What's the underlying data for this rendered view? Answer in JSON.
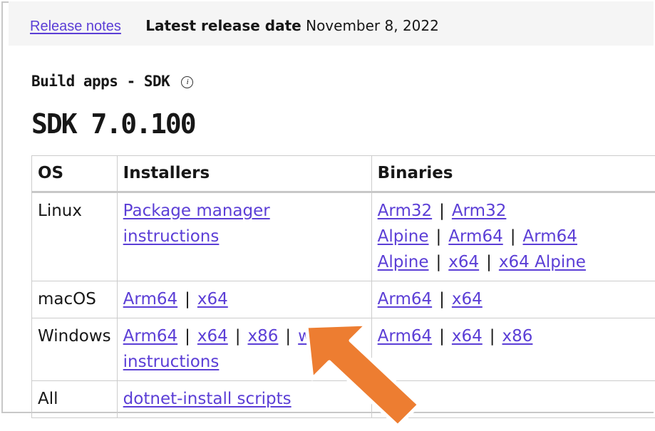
{
  "header": {
    "release_notes_link": "Release notes",
    "latest_release_label": "Latest release date",
    "latest_release_date": "November 8, 2022"
  },
  "section": {
    "title": "Build apps - SDK",
    "info_icon": "info-icon"
  },
  "sdk": {
    "title": "SDK 7.0.100"
  },
  "table": {
    "columns": [
      "OS",
      "Installers",
      "Binaries"
    ],
    "rows": [
      {
        "os": "Linux",
        "installers": [
          "Package manager instructions"
        ],
        "binaries": [
          "Arm32",
          "Arm32 Alpine",
          "Arm64",
          "Arm64 Alpine",
          "x64",
          "x64 Alpine"
        ]
      },
      {
        "os": "macOS",
        "installers": [
          "Arm64",
          "x64"
        ],
        "binaries": [
          "Arm64",
          "x64"
        ]
      },
      {
        "os": "Windows",
        "installers": [
          "Arm64",
          "x64",
          "x86",
          "winget instructions"
        ],
        "binaries": [
          "Arm64",
          "x64",
          "x86"
        ]
      },
      {
        "os": "All",
        "installers": [
          "dotnet-install scripts"
        ],
        "binaries": []
      }
    ]
  },
  "annotation": {
    "arrow_color": "#ed7d31",
    "arrow_icon": "arrow-pointer-icon"
  },
  "colors": {
    "link": "#5b3ed6",
    "header_bg": "#f5f5f5",
    "border": "#cccccc"
  }
}
